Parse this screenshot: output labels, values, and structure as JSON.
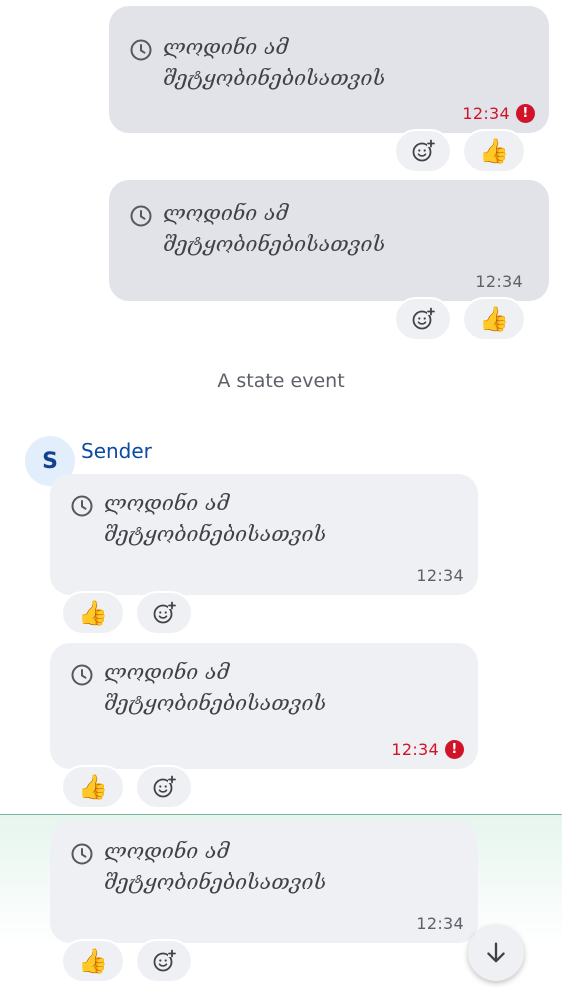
{
  "messages": [
    {
      "text": "ლოდინი ამ\nშეტყობინებისათვის",
      "time": "12:34",
      "error": true
    },
    {
      "text": "ლოდინი ამ\nშეტყობინებისათვის",
      "time": "12:34",
      "error": false
    },
    {
      "text": "ლოდინი ამ\nშეტყობინებისათვის",
      "time": "12:34",
      "error": false
    },
    {
      "text": "ლოდინი ამ\nშეტყობინებისათვის",
      "time": "12:34",
      "error": true
    },
    {
      "text": "ლოდინი ამ\nშეტყობინებისათვის",
      "time": "12:34",
      "error": false
    }
  ],
  "reaction": {
    "emoji": "👍"
  },
  "error_badge": "!",
  "state_event": "A state event",
  "sender": {
    "initial": "S",
    "name": "Sender"
  },
  "colors": {
    "outgoing_bubble": "#e1e3e8",
    "incoming_bubble": "#eff0f3",
    "error": "#d1132a",
    "sender_name": "#0b4aa5",
    "highlight": "#e6f5ed"
  },
  "icons": {
    "pending": "clock-icon",
    "add_reaction": "add-reaction-icon",
    "error": "error-icon",
    "scroll_down": "arrow-down-icon"
  }
}
